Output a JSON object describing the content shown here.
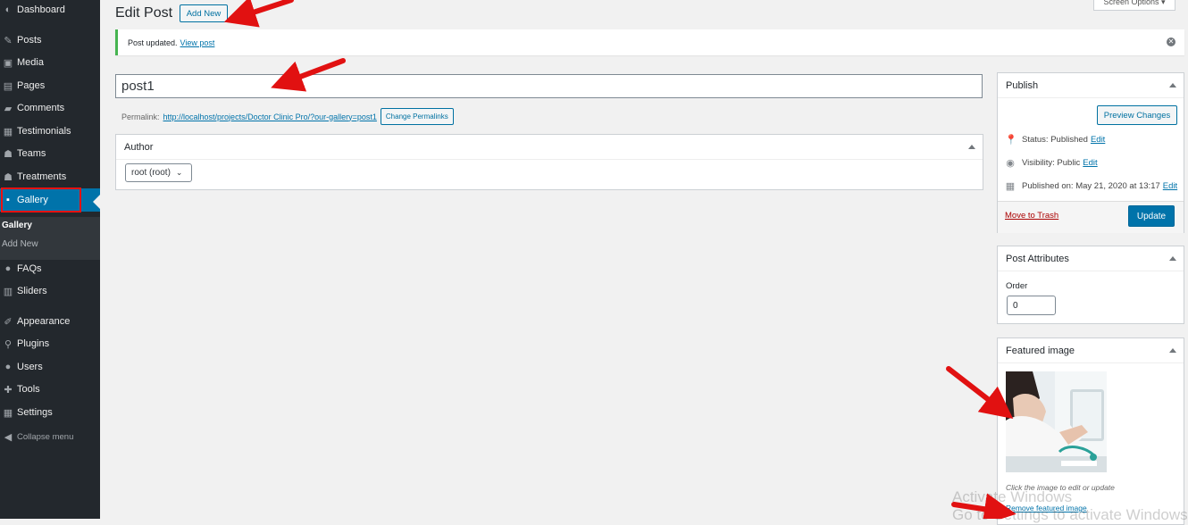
{
  "sidebar": {
    "items": [
      {
        "label": "Dashboard",
        "icon": "dashboard-icon"
      },
      {
        "label": "Posts",
        "icon": "pin-icon"
      },
      {
        "label": "Media",
        "icon": "media-icon"
      },
      {
        "label": "Pages",
        "icon": "pages-icon"
      },
      {
        "label": "Comments",
        "icon": "comments-icon"
      },
      {
        "label": "Testimonials",
        "icon": "testimonials-icon"
      },
      {
        "label": "Teams",
        "icon": "teams-icon"
      },
      {
        "label": "Treatments",
        "icon": "treatments-icon"
      },
      {
        "label": "Gallery",
        "icon": "gallery-icon"
      },
      {
        "label": "FAQs",
        "icon": "faq-icon"
      },
      {
        "label": "Sliders",
        "icon": "sliders-icon"
      },
      {
        "label": "Appearance",
        "icon": "appearance-icon"
      },
      {
        "label": "Plugins",
        "icon": "plugins-icon"
      },
      {
        "label": "Users",
        "icon": "users-icon"
      },
      {
        "label": "Tools",
        "icon": "tools-icon"
      },
      {
        "label": "Settings",
        "icon": "settings-icon"
      },
      {
        "label": "Collapse menu",
        "icon": "collapse-icon"
      }
    ],
    "submenu": [
      "Gallery",
      "Add New"
    ],
    "active_color": "#0073aa",
    "bg_color": "#23282d"
  },
  "header": {
    "title": "Edit Post",
    "add_new": "Add New",
    "screen_options": "Screen Options ▾"
  },
  "notice": {
    "text": "Post updated.",
    "link": "View post"
  },
  "post": {
    "title": "post1",
    "permalink_label": "Permalink:",
    "permalink_url": "http://localhost/projects/Doctor Clinic Pro/?our-gallery=post1",
    "change_permalinks": "Change Permalinks"
  },
  "author": {
    "heading": "Author",
    "value": "root (root)"
  },
  "publish": {
    "heading": "Publish",
    "preview": "Preview Changes",
    "status_label": "Status:",
    "status_value": "Published",
    "visibility_label": "Visibility:",
    "visibility_value": "Public",
    "published_label": "Published on:",
    "published_value": "May 21, 2020 at 13:17",
    "edit": "Edit",
    "trash": "Move to Trash",
    "update": "Update"
  },
  "attributes": {
    "heading": "Post Attributes",
    "order_label": "Order",
    "order_value": "0"
  },
  "featured": {
    "heading": "Featured image",
    "hint": "Click the image to edit or update",
    "remove": "Remove featured image"
  },
  "watermark": {
    "line1": "Activate Windows",
    "line2": "Go to Settings to activate Windows."
  },
  "colors": {
    "link": "#0073aa",
    "notice_success": "#46b450",
    "annotation": "#e11111"
  }
}
